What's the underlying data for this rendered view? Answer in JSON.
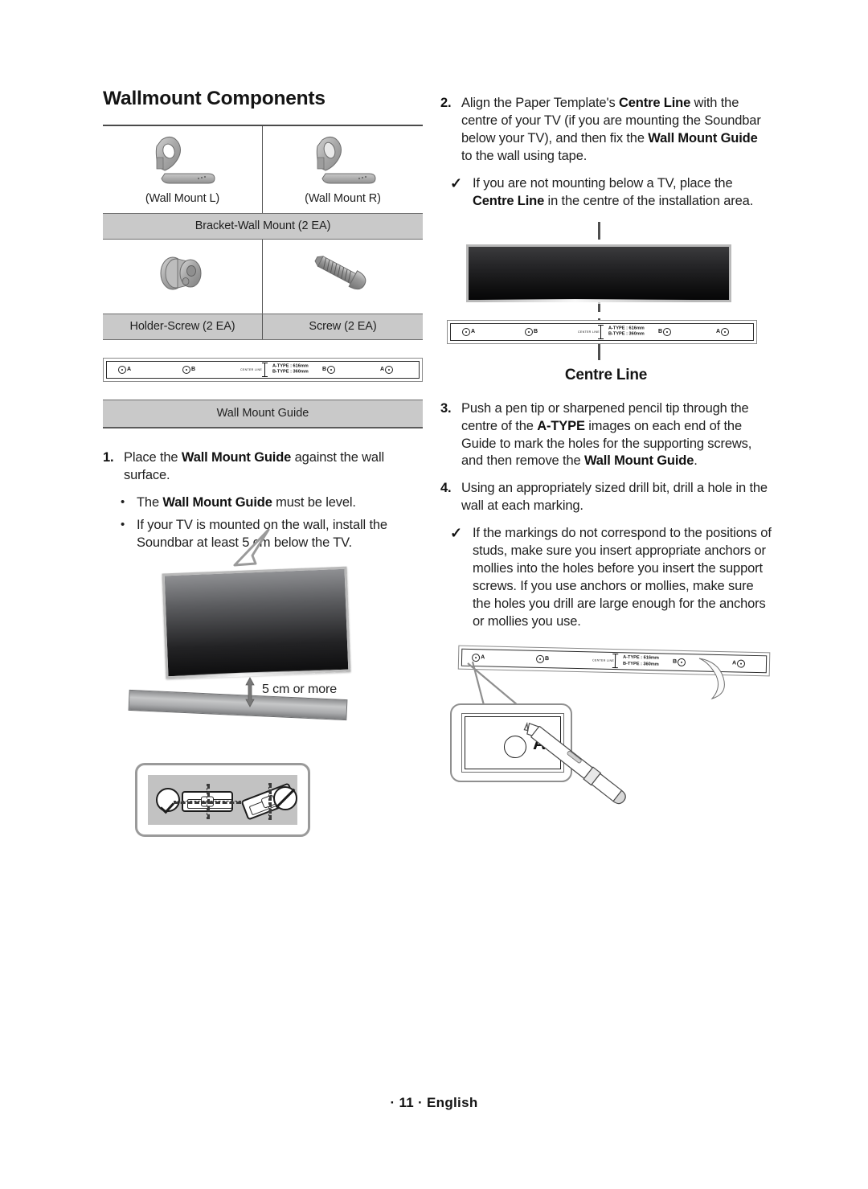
{
  "document": {
    "section_title": "Wallmount Components",
    "footer": "· 11 · English"
  },
  "components_table": {
    "rows": [
      {
        "items": [
          {
            "caption": "(Wall Mount L)",
            "icon": "wall-mount-bracket-left-icon"
          },
          {
            "caption": "(Wall Mount R)",
            "icon": "wall-mount-bracket-right-icon"
          }
        ],
        "band": "Bracket-Wall Mount (2 EA)",
        "band_split": false
      },
      {
        "items": [
          {
            "caption": "",
            "icon": "holder-screw-icon"
          },
          {
            "caption": "",
            "icon": "screw-icon"
          }
        ],
        "band_left": "Holder-Screw (2 EA)",
        "band_right": "Screw (2 EA)",
        "band_split": true
      }
    ],
    "guide_band": "Wall Mount Guide"
  },
  "wall_mount_guide": {
    "hole_labels": {
      "a": "A",
      "b": "B"
    },
    "centre_line_text": "CENTER LINE",
    "type_a": "A-TYPE : 616mm",
    "type_b": "B-TYPE : 360mm"
  },
  "left_column": {
    "step1": {
      "number": "1.",
      "text_before": "Place the ",
      "bold1": "Wall Mount Guide",
      "text_after": " against the wall surface."
    },
    "bullets": [
      {
        "dot": "•",
        "before": "The ",
        "bold": "Wall Mount Guide",
        "after": " must be level."
      },
      {
        "dot": "•",
        "before": "If your TV is mounted on the wall, install the Soundbar at least 5 cm below the TV.",
        "bold": "",
        "after": ""
      }
    ],
    "tv_figure": {
      "gap_label": "5 cm or more"
    }
  },
  "right_column": {
    "step2": {
      "number": "2.",
      "part1": "Align the Paper Template's ",
      "bold1": "Centre Line",
      "part2": " with the centre of your TV (if you are mounting the Soundbar below your TV), and then fix the ",
      "bold2": "Wall Mount Guide",
      "part3": " to the wall using tape."
    },
    "check1": {
      "mark": "✓",
      "part1": "If you are not mounting below a TV, place the ",
      "bold1": "Centre Line",
      "part2": " in the centre of the installation area."
    },
    "centre_figure": {
      "label": "Centre Line"
    },
    "step3": {
      "number": "3.",
      "part1": "Push a pen tip or sharpened pencil tip through the centre of the ",
      "bold1": "A-TYPE",
      "part2": " images on each end of the Guide to mark the holes for the supporting screws, and then remove the ",
      "bold2": "Wall Mount Guide",
      "part3": "."
    },
    "step4": {
      "number": "4.",
      "text": "Using an appropriately sized drill bit, drill a hole in the wall at each marking."
    },
    "check2": {
      "mark": "✓",
      "text": "If the markings do not correspond to the positions of studs, make sure you insert appropriate anchors or mollies into the holes before you insert the support screws. If you use anchors or mollies, make sure the holes you drill are large enough for the anchors or mollies you use."
    },
    "pencil_figure": {
      "hole_label": "A"
    }
  },
  "colors": {
    "band_gray": "#c9c9c9",
    "rule_dark": "#4a4a4a",
    "text": "#1f1f1f"
  }
}
